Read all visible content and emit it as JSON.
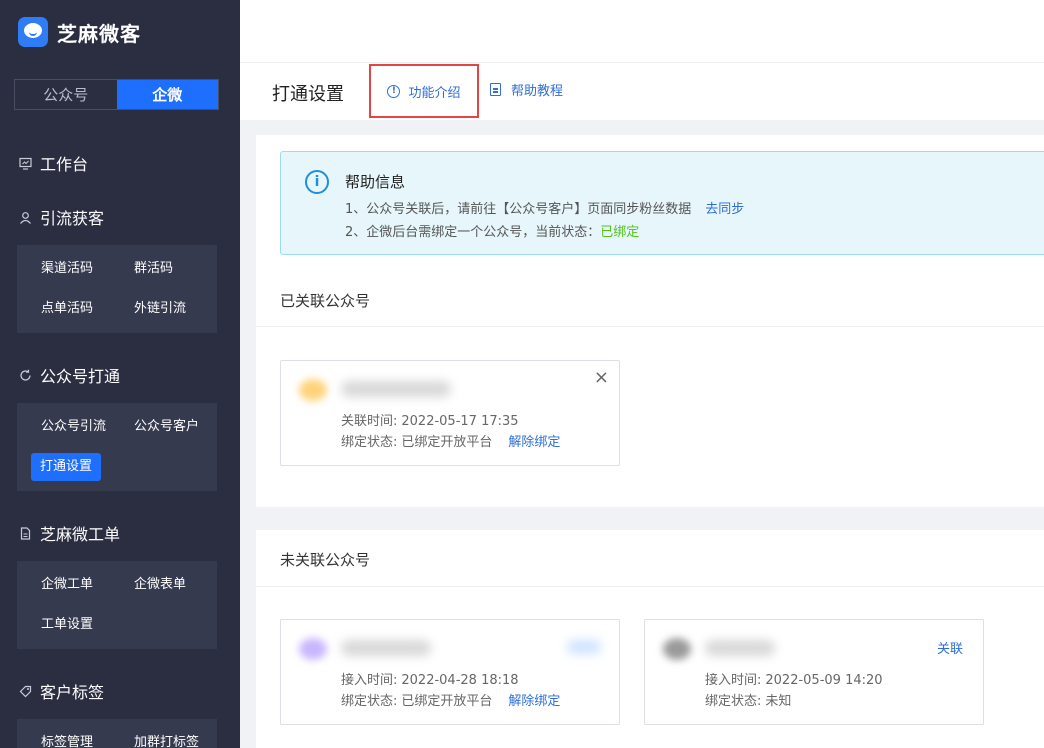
{
  "brand": {
    "name": "芝麻微客"
  },
  "switch": {
    "left": "公众号",
    "right": "企微"
  },
  "nav": {
    "workbench": "工作台",
    "lead": {
      "title": "引流获客",
      "items": [
        "渠道活码",
        "群活码",
        "点单活码",
        "外链引流"
      ]
    },
    "mp": {
      "title": "公众号打通",
      "items": [
        "公众号引流",
        "公众号客户",
        "打通设置"
      ]
    },
    "ticket": {
      "title": "芝麻微工单",
      "items": [
        "企微工单",
        "企微表单",
        "工单设置"
      ]
    },
    "tags": {
      "title": "客户标签",
      "items": [
        "标签管理",
        "加群打标签"
      ]
    }
  },
  "header": {
    "title": "打通设置",
    "intro": "功能介绍",
    "help": "帮助教程"
  },
  "help_box": {
    "title": "帮助信息",
    "line1": "1、公众号关联后，请前往【公众号客户】页面同步粉丝数据",
    "line1_link": "去同步",
    "line2": "2、企微后台需绑定一个公众号，当前状态：",
    "line2_status": "已绑定"
  },
  "linked": {
    "title": "已关联公众号",
    "card": {
      "time_label": "关联时间:",
      "time": "2022-05-17 17:35",
      "status_label": "绑定状态:",
      "status": "已绑定开放平台",
      "action": "解除绑定",
      "close": "×"
    }
  },
  "unlinked": {
    "title": "未关联公众号",
    "cards": [
      {
        "time_label": "接入时间:",
        "time": "2022-04-28 18:18",
        "status_label": "绑定状态:",
        "status": "已绑定开放平台",
        "action": "解除绑定"
      },
      {
        "time_label": "接入时间:",
        "time": "2022-05-09 14:20",
        "status_label": "绑定状态:",
        "status": "未知",
        "associate": "关联"
      }
    ]
  },
  "colors": {
    "sidebar": "#2b2e40",
    "accent": "#1f6fff",
    "link": "#2f6fd6",
    "success": "#52c41a",
    "highlight": "#e34444"
  }
}
